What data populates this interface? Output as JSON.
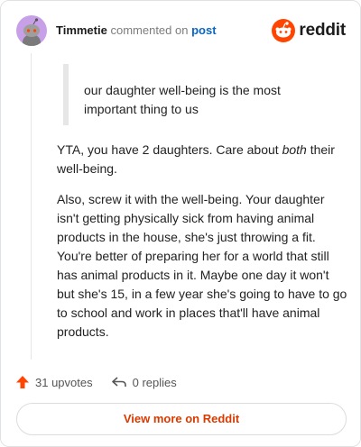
{
  "comment": {
    "author": "Timmetie",
    "action_text": "commented on",
    "post_link": "post",
    "quote": "our daughter well-being is the most important thing to us",
    "paragraph1_a": "YTA, you have 2 daughters. Care about ",
    "paragraph1_em": "both",
    "paragraph1_b": " their well-being.",
    "paragraph2": "Also, screw it with the well-being. Your daughter isn't getting physically sick from having animal products in the house, she's just throwing a fit. You're better of preparing her for a world that still has animal products in it. Maybe one day it won't but she's 15, in a few year she's going to have to go to school and work in places that'll have animal products."
  },
  "logo": {
    "wordmark": "reddit"
  },
  "actions": {
    "upvotes_label": "31 upvotes",
    "replies_label": "0 replies"
  },
  "footer": {
    "view_more_label": "View more on Reddit"
  },
  "colors": {
    "brand": "#ff4500",
    "link": "#0a66c2",
    "view_more": "#d93a00",
    "avatar_bg": "#c8a0e8"
  }
}
